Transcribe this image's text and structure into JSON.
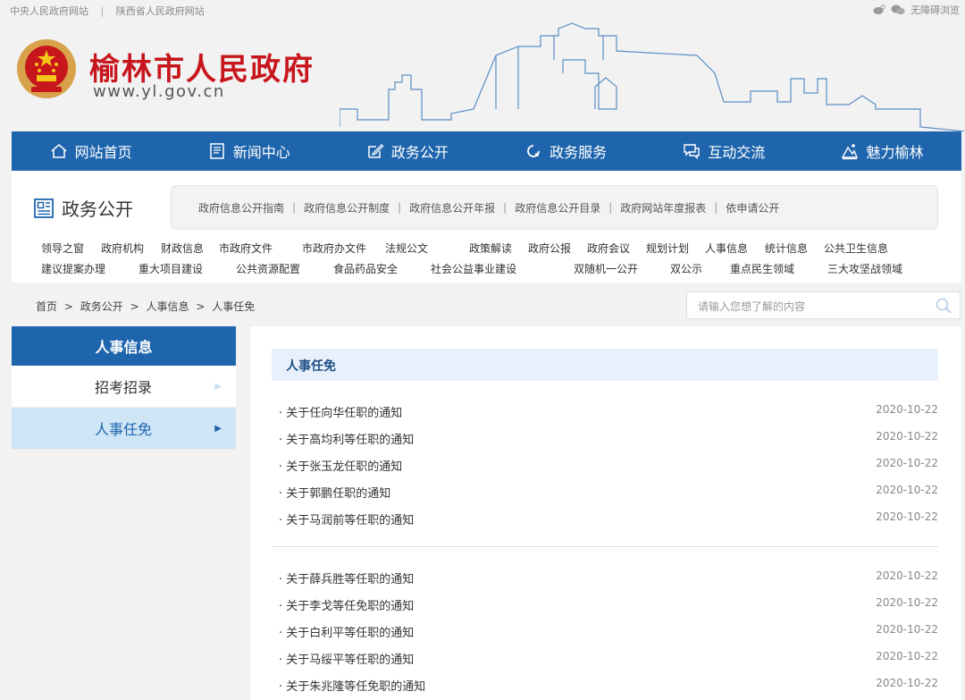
{
  "topbar": {
    "links": [
      "中央人民政府网站",
      "陕西省人民政府网站"
    ],
    "separator": "|",
    "accessibility": "无障碍浏览",
    "icons": [
      "weibo-icon",
      "wechat-icon"
    ]
  },
  "header": {
    "title": "榆林市人民政府",
    "url": "www.yl.gov.cn"
  },
  "nav": [
    {
      "label": "网站首页",
      "icon": "home-icon"
    },
    {
      "label": "新闻中心",
      "icon": "news-icon"
    },
    {
      "label": "政务公开",
      "icon": "edit-icon"
    },
    {
      "label": "政务服务",
      "icon": "service-icon"
    },
    {
      "label": "互动交流",
      "icon": "chat-icon"
    },
    {
      "label": "魅力榆林",
      "icon": "charm-icon"
    }
  ],
  "section": {
    "title": "政务公开",
    "links": [
      "政府信息公开指南",
      "政府信息公开制度",
      "政府信息公开年报",
      "政府信息公开目录",
      "政府网站年度报表",
      "依申请公开"
    ],
    "row1": [
      "领导之窗",
      "政府机构",
      "财政信息",
      "市政府文件",
      "市政府办文件",
      "法规公文",
      "政策解读",
      "政府公报",
      "政府会议",
      "规划计划",
      "人事信息",
      "统计信息",
      "公共卫生信息"
    ],
    "row2": [
      "建议提案办理",
      "重大项目建设",
      "公共资源配置",
      "食品药品安全",
      "社会公益事业建设",
      "双随机一公开",
      "双公示",
      "重点民生领域",
      "三大攻坚战领域"
    ]
  },
  "breadcrumb": {
    "items": [
      "首页",
      "政务公开",
      "人事信息",
      "人事任免"
    ],
    "separator": ">"
  },
  "search": {
    "placeholder": "请输入您想了解的内容"
  },
  "sidebar": {
    "title": "人事信息",
    "items": [
      {
        "label": "招考招录",
        "active": false
      },
      {
        "label": "人事任免",
        "active": true
      }
    ]
  },
  "main": {
    "title": "人事任免",
    "group1": [
      {
        "title": "关于任向华任职的通知",
        "date": "2020-10-22"
      },
      {
        "title": "关于高均利等任职的通知",
        "date": "2020-10-22"
      },
      {
        "title": "关于张玉龙任职的通知",
        "date": "2020-10-22"
      },
      {
        "title": "关于郭鹏任职的通知",
        "date": "2020-10-22"
      },
      {
        "title": "关于马润前等任职的通知",
        "date": "2020-10-22"
      }
    ],
    "group2": [
      {
        "title": "关于薛兵胜等任职的通知",
        "date": "2020-10-22"
      },
      {
        "title": "关于李戈等任免职的通知",
        "date": "2020-10-22"
      },
      {
        "title": "关于白利平等任职的通知",
        "date": "2020-10-22"
      },
      {
        "title": "关于马绥平等任职的通知",
        "date": "2020-10-22"
      },
      {
        "title": "关于朱兆隆等任免职的通知",
        "date": "2020-10-22"
      }
    ]
  },
  "colors": {
    "brand_red": "#c8161d",
    "nav_blue": "#1f65ad",
    "active_bg": "#cfe6f7"
  }
}
